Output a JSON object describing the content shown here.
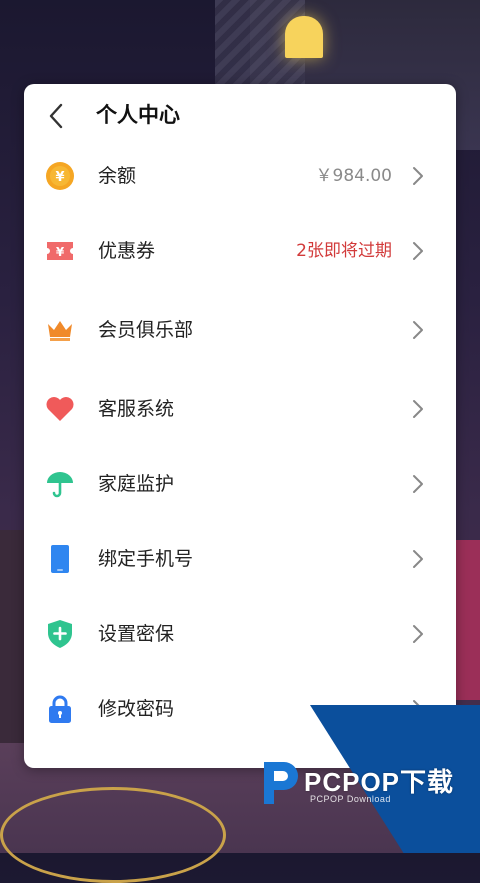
{
  "header": {
    "title": "个人中心"
  },
  "menu": [
    {
      "label": "余额",
      "value": "￥984.00",
      "icon": "coin-icon",
      "value_color": "#8a8a8a"
    },
    {
      "label": "优惠券",
      "value": "2张即将过期",
      "icon": "ticket-icon",
      "value_color": "#d23a3a"
    },
    {
      "label": "会员俱乐部",
      "value": "",
      "icon": "crown-icon"
    },
    {
      "label": "客服系统",
      "value": "",
      "icon": "heart-icon"
    },
    {
      "label": "家庭监护",
      "value": "",
      "icon": "umbrella-icon"
    },
    {
      "label": "绑定手机号",
      "value": "",
      "icon": "phone-icon"
    },
    {
      "label": "设置密保",
      "value": "",
      "icon": "shield-plus-icon"
    },
    {
      "label": "修改密码",
      "value": "",
      "icon": "lock-icon"
    }
  ],
  "watermark": {
    "brand": "PCPOP下载",
    "sub": "PCPOP Download"
  },
  "colors": {
    "coin": "#f5a623",
    "ticket": "#f06a6a",
    "crown": "#f08a2a",
    "heart": "#f05a5a",
    "umbrella": "#2fc48f",
    "phone": "#2f86f0",
    "shield": "#2fc48f",
    "lock": "#2f7af0",
    "watermark": "#0b4f9c"
  }
}
